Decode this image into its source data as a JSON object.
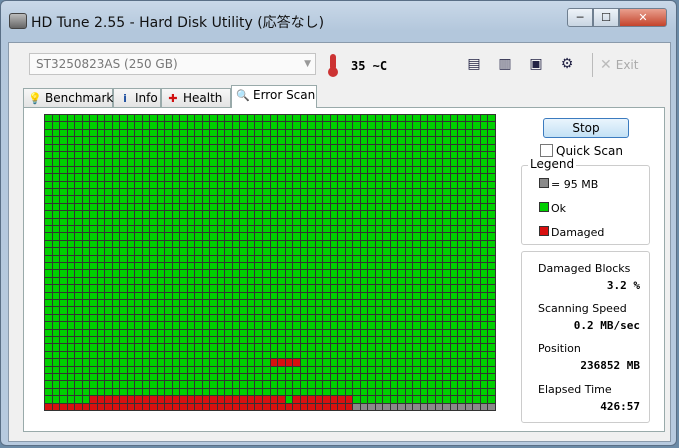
{
  "window": {
    "title": "HD Tune 2.55 - Hard Disk Utility (応答なし)",
    "min_label": "─",
    "max_label": "☐",
    "close_label": "✕"
  },
  "toolbar": {
    "drive": "ST3250823AS (250 GB)",
    "temperature": "35 ~C",
    "exit_label": "Exit",
    "exit_glyph": "✕"
  },
  "tabs": [
    {
      "label": "Benchmark",
      "icon": "lightbulb-icon"
    },
    {
      "label": "Info",
      "icon": "info-icon"
    },
    {
      "label": "Health",
      "icon": "health-cross-icon"
    },
    {
      "label": "Error Scan",
      "icon": "magnifier-icon"
    }
  ],
  "scan": {
    "stop_label": "Stop",
    "quick_scan_label": "Quick Scan",
    "quick_scan_checked": false
  },
  "legend": {
    "title": "Legend",
    "block_size": "= 95 MB",
    "ok": "Ok",
    "damaged": "Damaged"
  },
  "stats": {
    "damaged_label": "Damaged Blocks",
    "damaged_value": "3.2 %",
    "speed_label": "Scanning Speed",
    "speed_value": "0.2 MB/sec",
    "position_label": "Position",
    "position_value": "236852 MB",
    "elapsed_label": "Elapsed Time",
    "elapsed_value": "426:57"
  },
  "colors": {
    "ok": "#00d000",
    "damaged": "#d81010",
    "unscanned": "#8a8a8a"
  }
}
